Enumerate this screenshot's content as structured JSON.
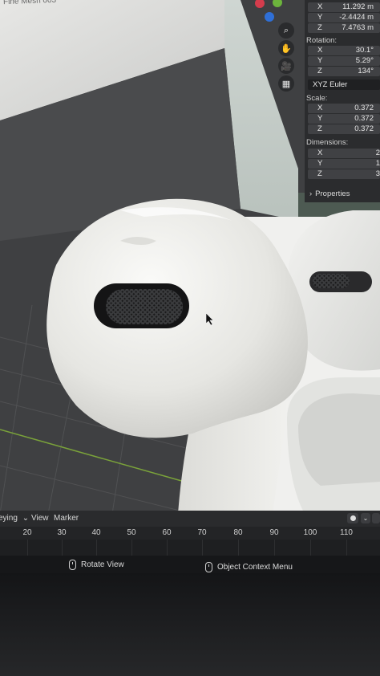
{
  "viewport": {
    "title": "Fine Mesh 003",
    "gizmo_colors": {
      "x": "#d43c4c",
      "y": "#6cb43c",
      "z": "#2f6fd6"
    }
  },
  "nav_buttons": [
    {
      "icon": "zoom-icon",
      "glyph": "⌕"
    },
    {
      "icon": "hand-pan-icon",
      "glyph": "✋"
    },
    {
      "icon": "camera-icon",
      "glyph": "🎥"
    },
    {
      "icon": "grid-icon",
      "glyph": "▦"
    }
  ],
  "n_panel": {
    "location": [
      {
        "axis": "X",
        "value": "11.292 m"
      },
      {
        "axis": "Y",
        "value": "-2.4424 m"
      },
      {
        "axis": "Z",
        "value": "7.4763 m"
      }
    ],
    "rotation_label": "Rotation:",
    "rotation": [
      {
        "axis": "X",
        "value": "30.1°"
      },
      {
        "axis": "Y",
        "value": "5.29°"
      },
      {
        "axis": "Z",
        "value": "134°"
      }
    ],
    "rotation_mode": "XYZ Euler",
    "scale_label": "Scale:",
    "scale": [
      {
        "axis": "X",
        "value": "0.372"
      },
      {
        "axis": "Y",
        "value": "0.372"
      },
      {
        "axis": "Z",
        "value": "0.372"
      }
    ],
    "dimensions_label": "Dimensions:",
    "dimensions": [
      {
        "axis": "X",
        "value": "2"
      },
      {
        "axis": "Y",
        "value": "1"
      },
      {
        "axis": "Z",
        "value": "3"
      }
    ],
    "properties_label": "Properties"
  },
  "timeline": {
    "mode_label": "eying",
    "view_label": "View",
    "marker_label": "Marker",
    "frames": [
      "20",
      "30",
      "40",
      "50",
      "60",
      "70",
      "80",
      "90",
      "100",
      "110"
    ]
  },
  "status_bar": {
    "rotate_view": "Rotate View",
    "context_menu": "Object Context Menu"
  }
}
